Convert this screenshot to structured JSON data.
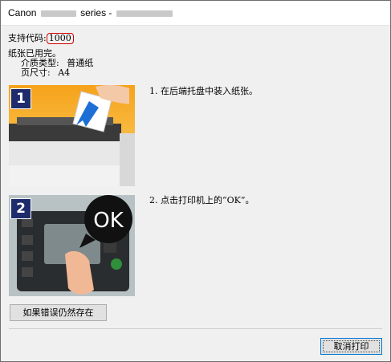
{
  "window": {
    "title_brand": "Canon",
    "title_series": "series -"
  },
  "support": {
    "label": "支持代码:",
    "code": "1000"
  },
  "message": {
    "line1": "纸张已用完。",
    "media_label": "介质类型:",
    "media_value": "普通纸",
    "size_label": "页尺寸:",
    "size_value": "A4"
  },
  "steps": [
    {
      "num": "1",
      "text": "1. 在后端托盘中装入纸张。"
    },
    {
      "num": "2",
      "text": "2. 点击打印机上的“OK”。"
    }
  ],
  "step2_image": {
    "ok_label": "OK"
  },
  "buttons": {
    "persist": "如果错误仍然存在",
    "cancel": "取消打印"
  }
}
